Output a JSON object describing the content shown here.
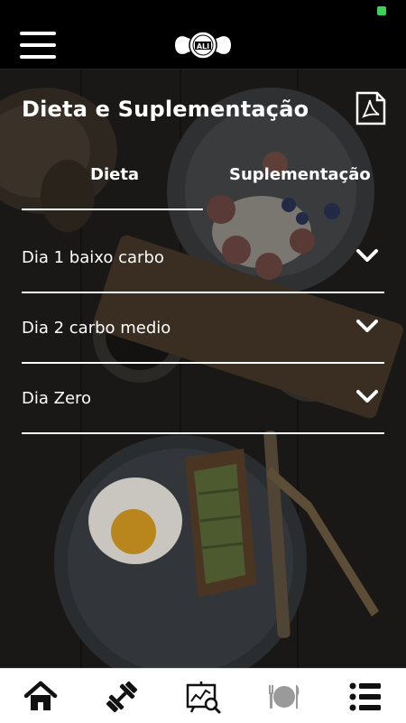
{
  "header": {
    "logo_text": "ALI",
    "menu_icon": "hamburger-icon"
  },
  "page": {
    "title": "Dieta e Suplementação",
    "pdf_icon": "pdf-icon"
  },
  "tabs": [
    {
      "label": "Dieta",
      "active": true
    },
    {
      "label": "Suplementação",
      "active": false
    }
  ],
  "diet_days": [
    {
      "label": "Dia 1 baixo carbo"
    },
    {
      "label": "Dia 2 carbo medio"
    },
    {
      "label": "Dia Zero"
    }
  ],
  "bottom_nav": [
    {
      "icon": "home-icon"
    },
    {
      "icon": "dumbbell-icon"
    },
    {
      "icon": "presentation-analytics-icon"
    },
    {
      "icon": "plate-cutlery-icon",
      "active": true
    },
    {
      "icon": "list-icon"
    }
  ],
  "colors": {
    "header_bg": "#000000",
    "text": "#ffffff",
    "nav_bg": "#ffffff",
    "nav_icon": "#111111",
    "nav_icon_active": "#9a9a9a"
  }
}
